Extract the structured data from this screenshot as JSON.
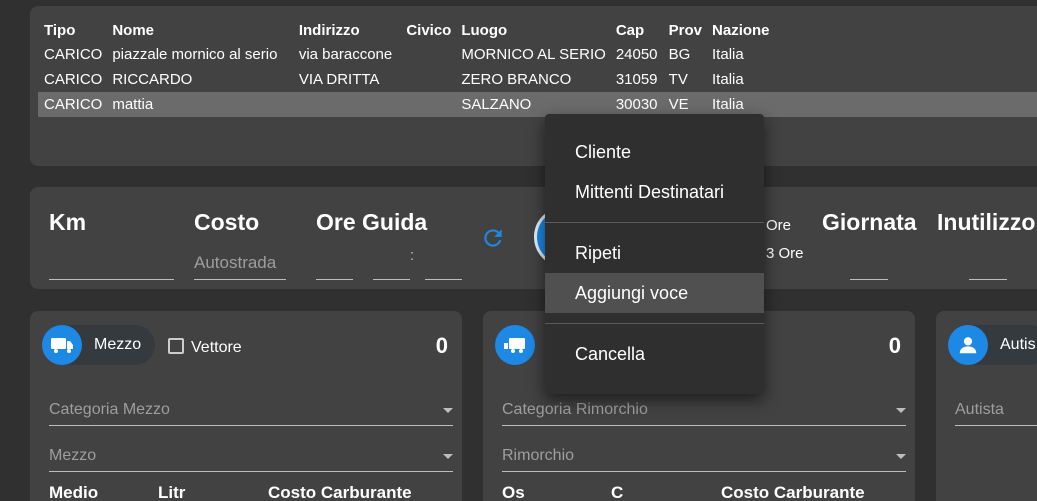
{
  "table": {
    "headers": [
      "Tipo",
      "Nome",
      "Indirizzo",
      "Civico",
      "Luogo",
      "Cap",
      "Prov",
      "Nazione"
    ],
    "rows": [
      [
        "CARICO",
        "piazzale mornico al serio",
        "via baraccone",
        "",
        "MORNICO AL SERIO",
        "24050",
        "BG",
        "Italia"
      ],
      [
        "CARICO",
        "RICCARDO",
        "VIA DRITTA",
        "",
        "ZERO BRANCO",
        "31059",
        "TV",
        "Italia"
      ],
      [
        "CARICO",
        "mattia",
        "",
        "",
        "SALZANO",
        "30030",
        "VE",
        "Italia"
      ]
    ]
  },
  "summary": {
    "km_label": "Km",
    "costo_label": "Costo",
    "autostrada_placeholder": "Autostrada",
    "ore_guida_label": "Ore Guida",
    "time_separator": ":",
    "ore_label": "Ore",
    "ore_value_prefix": "3",
    "ore_value_label": "Ore",
    "giornata_label": "Giornata",
    "inutilizzo_label": "Inutilizzo"
  },
  "cards": {
    "mezzo": {
      "chip_label": "Mezzo",
      "vettore_label": "Vettore",
      "count": "0",
      "categoria_label": "Categoria Mezzo",
      "mezzo_label": "Mezzo",
      "footer_left": "Medio",
      "footer_mid": "Litr",
      "footer_right": "Costo Carburante"
    },
    "rimorchio": {
      "count": "0",
      "categoria_label": "Categoria Rimorchio",
      "rimorchio_label": "Rimorchio",
      "footer_left": "Os",
      "footer_mid": "C",
      "footer_right": "Costo Carburante"
    },
    "autista": {
      "chip_label": "Autis",
      "autista_label": "Autista"
    }
  },
  "context_menu": {
    "items": [
      "Cliente",
      "Mittenti Destinatari",
      "Ripeti",
      "Aggiungi voce",
      "Cancella"
    ]
  },
  "colors": {
    "accent": "#1e88e5",
    "panel": "#424242",
    "background": "#303030",
    "menu": "#2f2f2f"
  }
}
